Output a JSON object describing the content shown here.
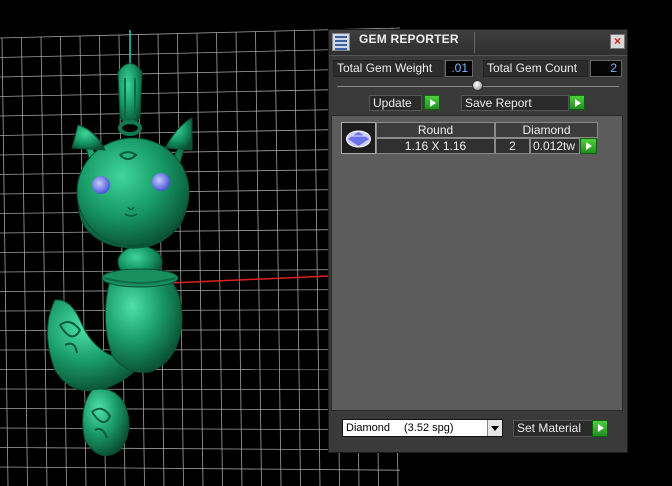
{
  "panel": {
    "title": "GEM REPORTER",
    "close_label": "×"
  },
  "totals": {
    "weight_label": "Total Gem Weight",
    "weight_value": ".01",
    "count_label": "Total Gem Count",
    "count_value": "2"
  },
  "actions": {
    "update_label": "Update",
    "save_label": "Save Report"
  },
  "report": {
    "rows": [
      {
        "shape": "Round",
        "material": "Diamond",
        "size": "1.16 X 1.16",
        "count": "2",
        "weight": "0.012tw"
      }
    ]
  },
  "material": {
    "selected_name": "Diamond",
    "selected_spg": "(3.52 spg)",
    "set_label": "Set Material"
  },
  "colors": {
    "model": "#1f9e6b",
    "grid": "#bdbdbd",
    "panel_bg": "#3a3a3a",
    "report_bg": "#5c5c5c",
    "value_text": "#7fb3ff",
    "go_button": "#2eaf2e"
  },
  "icons": {
    "app": "report-icon",
    "close": "close-icon",
    "go": "play-arrow-icon",
    "gem": "gem-icon",
    "dropdown": "chevron-down-icon"
  }
}
